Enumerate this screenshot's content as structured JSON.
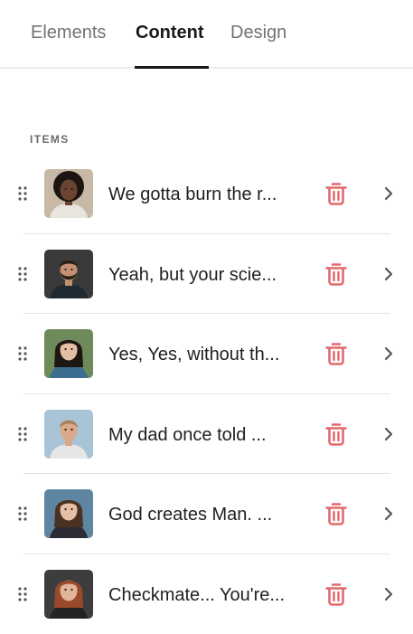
{
  "tabs": [
    {
      "label": "Elements",
      "active": false
    },
    {
      "label": "Content",
      "active": true
    },
    {
      "label": "Design",
      "active": false
    }
  ],
  "section": {
    "label": "ITEMS"
  },
  "colors": {
    "accent": "#1a1a1a",
    "delete": "#e06a6f",
    "muted": "#737373"
  },
  "items": [
    {
      "text": "We gotta burn the r...",
      "avatar": "person-curly-hair-smiling"
    },
    {
      "text": "Yeah, but your scie...",
      "avatar": "person-bearded-man"
    },
    {
      "text": "Yes, Yes, without th...",
      "avatar": "person-woman-dark-hair"
    },
    {
      "text": "My dad once told ...",
      "avatar": "person-man-outdoors"
    },
    {
      "text": "God creates Man. ...",
      "avatar": "person-woman-bob-hair"
    },
    {
      "text": "Checkmate... You're...",
      "avatar": "person-woman-red-hair"
    }
  ]
}
